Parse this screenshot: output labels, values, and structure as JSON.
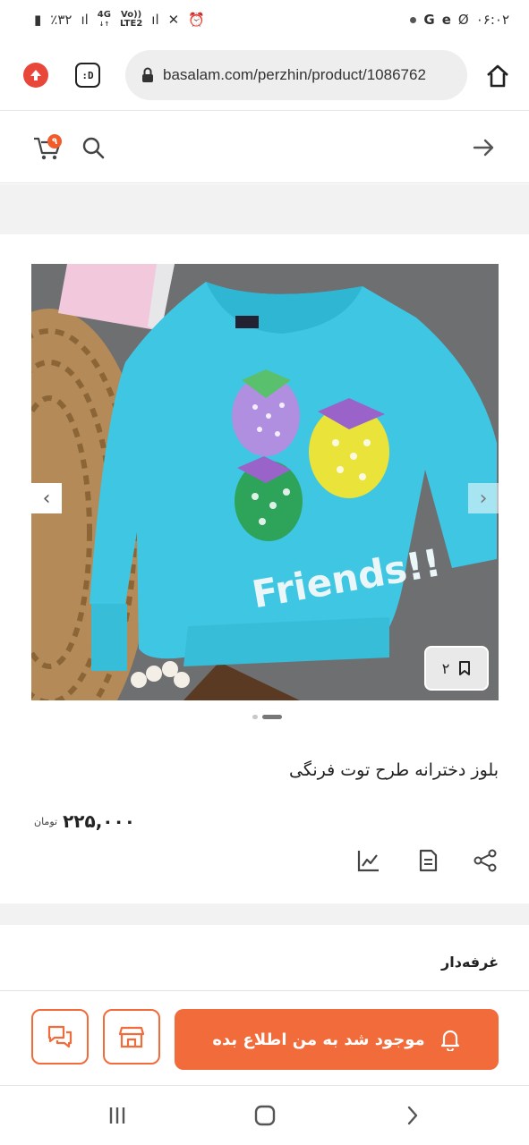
{
  "status_bar": {
    "battery": "٪۳۲",
    "network_1": "4G",
    "network_2": "LTE2",
    "volte": "Vo))",
    "time": "۰۶:۰۲",
    "apps": [
      "G",
      "e",
      "Ø"
    ]
  },
  "browser": {
    "url": "basalam.com/perzhin/product/1086762",
    "extension_label": ":D"
  },
  "header": {
    "cart_count": "۹"
  },
  "product": {
    "title": "بلوز دخترانه طرح توت فرنگی",
    "price": "۲۲۵,۰۰۰",
    "currency": "تومان",
    "bookmark_count": "۲",
    "image_text": "Friends!!",
    "image_count": 2,
    "active_image_index": 2
  },
  "seller": {
    "label": "غرفه‌دار"
  },
  "actions": {
    "notify_label": "موجود شد به من اطلاع بده"
  },
  "colors": {
    "accent": "#f26b3a",
    "shirt": "#3fc6e2",
    "badge": "#f25b2a"
  }
}
